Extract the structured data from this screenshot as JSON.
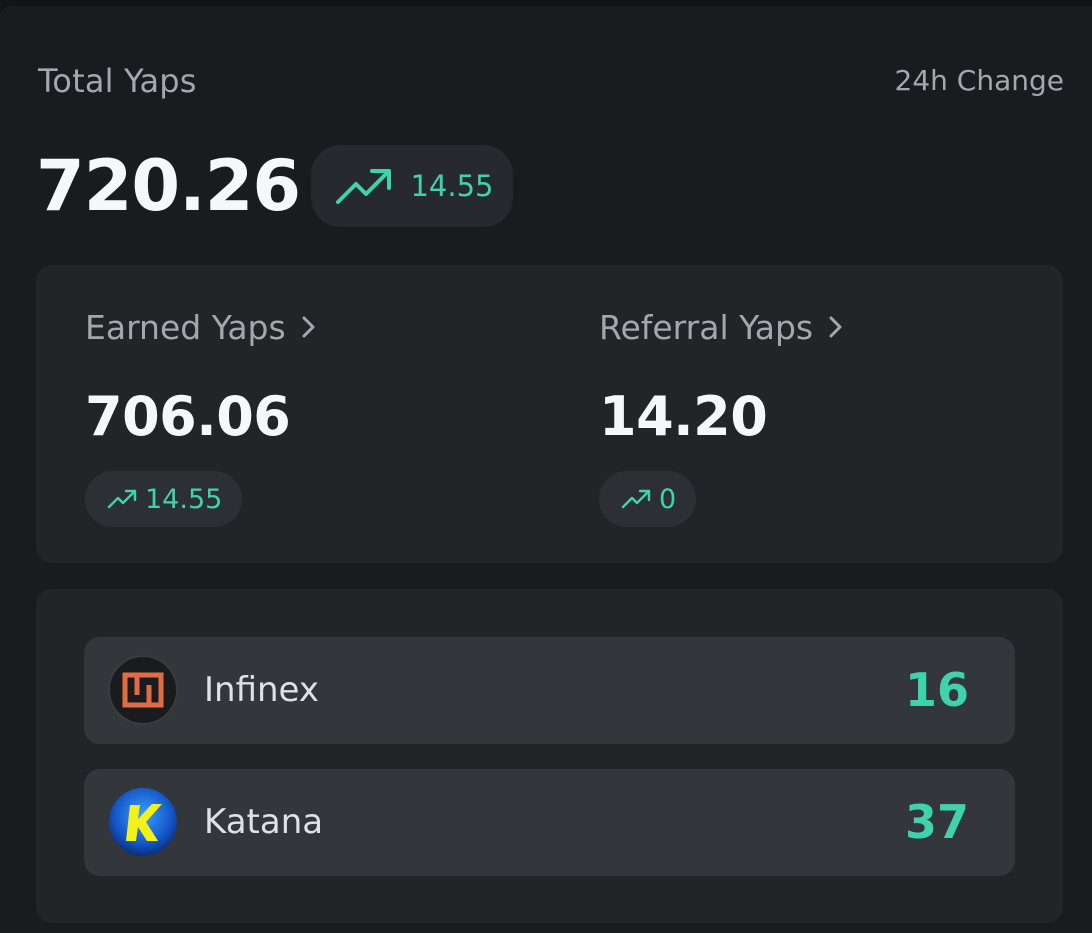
{
  "header": {
    "total_label": "Total Yaps",
    "change_label": "24h Change"
  },
  "total": {
    "value": "720.26",
    "change": "14.55"
  },
  "stats": {
    "earned": {
      "title": "Earned Yaps",
      "value": "706.06",
      "change": "14.55"
    },
    "referral": {
      "title": "Referral Yaps",
      "value": "14.20",
      "change": "0"
    }
  },
  "projects": [
    {
      "name": "Infinex",
      "count": "16",
      "icon": "infinex-logo-icon"
    },
    {
      "name": "Katana",
      "count": "37",
      "icon": "katana-logo-icon"
    }
  ],
  "colors": {
    "background": "#121417",
    "panel": "#191b1f",
    "card": "#222428",
    "row": "#33363b",
    "accent": "#3fd3ad",
    "muted_text": "#a4a7ad",
    "primary_text": "#f6f7f8"
  }
}
